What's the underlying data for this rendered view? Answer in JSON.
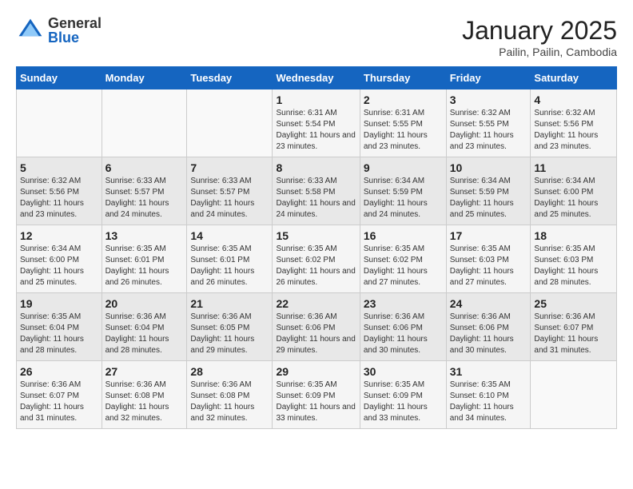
{
  "header": {
    "logo_general": "General",
    "logo_blue": "Blue",
    "title": "January 2025",
    "subtitle": "Pailin, Pailin, Cambodia"
  },
  "calendar": {
    "days_of_week": [
      "Sunday",
      "Monday",
      "Tuesday",
      "Wednesday",
      "Thursday",
      "Friday",
      "Saturday"
    ],
    "weeks": [
      [
        {
          "day": "",
          "info": ""
        },
        {
          "day": "",
          "info": ""
        },
        {
          "day": "",
          "info": ""
        },
        {
          "day": "1",
          "info": "Sunrise: 6:31 AM\nSunset: 5:54 PM\nDaylight: 11 hours and 23 minutes."
        },
        {
          "day": "2",
          "info": "Sunrise: 6:31 AM\nSunset: 5:55 PM\nDaylight: 11 hours and 23 minutes."
        },
        {
          "day": "3",
          "info": "Sunrise: 6:32 AM\nSunset: 5:55 PM\nDaylight: 11 hours and 23 minutes."
        },
        {
          "day": "4",
          "info": "Sunrise: 6:32 AM\nSunset: 5:56 PM\nDaylight: 11 hours and 23 minutes."
        }
      ],
      [
        {
          "day": "5",
          "info": "Sunrise: 6:32 AM\nSunset: 5:56 PM\nDaylight: 11 hours and 23 minutes."
        },
        {
          "day": "6",
          "info": "Sunrise: 6:33 AM\nSunset: 5:57 PM\nDaylight: 11 hours and 24 minutes."
        },
        {
          "day": "7",
          "info": "Sunrise: 6:33 AM\nSunset: 5:57 PM\nDaylight: 11 hours and 24 minutes."
        },
        {
          "day": "8",
          "info": "Sunrise: 6:33 AM\nSunset: 5:58 PM\nDaylight: 11 hours and 24 minutes."
        },
        {
          "day": "9",
          "info": "Sunrise: 6:34 AM\nSunset: 5:59 PM\nDaylight: 11 hours and 24 minutes."
        },
        {
          "day": "10",
          "info": "Sunrise: 6:34 AM\nSunset: 5:59 PM\nDaylight: 11 hours and 25 minutes."
        },
        {
          "day": "11",
          "info": "Sunrise: 6:34 AM\nSunset: 6:00 PM\nDaylight: 11 hours and 25 minutes."
        }
      ],
      [
        {
          "day": "12",
          "info": "Sunrise: 6:34 AM\nSunset: 6:00 PM\nDaylight: 11 hours and 25 minutes."
        },
        {
          "day": "13",
          "info": "Sunrise: 6:35 AM\nSunset: 6:01 PM\nDaylight: 11 hours and 26 minutes."
        },
        {
          "day": "14",
          "info": "Sunrise: 6:35 AM\nSunset: 6:01 PM\nDaylight: 11 hours and 26 minutes."
        },
        {
          "day": "15",
          "info": "Sunrise: 6:35 AM\nSunset: 6:02 PM\nDaylight: 11 hours and 26 minutes."
        },
        {
          "day": "16",
          "info": "Sunrise: 6:35 AM\nSunset: 6:02 PM\nDaylight: 11 hours and 27 minutes."
        },
        {
          "day": "17",
          "info": "Sunrise: 6:35 AM\nSunset: 6:03 PM\nDaylight: 11 hours and 27 minutes."
        },
        {
          "day": "18",
          "info": "Sunrise: 6:35 AM\nSunset: 6:03 PM\nDaylight: 11 hours and 28 minutes."
        }
      ],
      [
        {
          "day": "19",
          "info": "Sunrise: 6:35 AM\nSunset: 6:04 PM\nDaylight: 11 hours and 28 minutes."
        },
        {
          "day": "20",
          "info": "Sunrise: 6:36 AM\nSunset: 6:04 PM\nDaylight: 11 hours and 28 minutes."
        },
        {
          "day": "21",
          "info": "Sunrise: 6:36 AM\nSunset: 6:05 PM\nDaylight: 11 hours and 29 minutes."
        },
        {
          "day": "22",
          "info": "Sunrise: 6:36 AM\nSunset: 6:06 PM\nDaylight: 11 hours and 29 minutes."
        },
        {
          "day": "23",
          "info": "Sunrise: 6:36 AM\nSunset: 6:06 PM\nDaylight: 11 hours and 30 minutes."
        },
        {
          "day": "24",
          "info": "Sunrise: 6:36 AM\nSunset: 6:06 PM\nDaylight: 11 hours and 30 minutes."
        },
        {
          "day": "25",
          "info": "Sunrise: 6:36 AM\nSunset: 6:07 PM\nDaylight: 11 hours and 31 minutes."
        }
      ],
      [
        {
          "day": "26",
          "info": "Sunrise: 6:36 AM\nSunset: 6:07 PM\nDaylight: 11 hours and 31 minutes."
        },
        {
          "day": "27",
          "info": "Sunrise: 6:36 AM\nSunset: 6:08 PM\nDaylight: 11 hours and 32 minutes."
        },
        {
          "day": "28",
          "info": "Sunrise: 6:36 AM\nSunset: 6:08 PM\nDaylight: 11 hours and 32 minutes."
        },
        {
          "day": "29",
          "info": "Sunrise: 6:35 AM\nSunset: 6:09 PM\nDaylight: 11 hours and 33 minutes."
        },
        {
          "day": "30",
          "info": "Sunrise: 6:35 AM\nSunset: 6:09 PM\nDaylight: 11 hours and 33 minutes."
        },
        {
          "day": "31",
          "info": "Sunrise: 6:35 AM\nSunset: 6:10 PM\nDaylight: 11 hours and 34 minutes."
        },
        {
          "day": "",
          "info": ""
        }
      ]
    ]
  }
}
